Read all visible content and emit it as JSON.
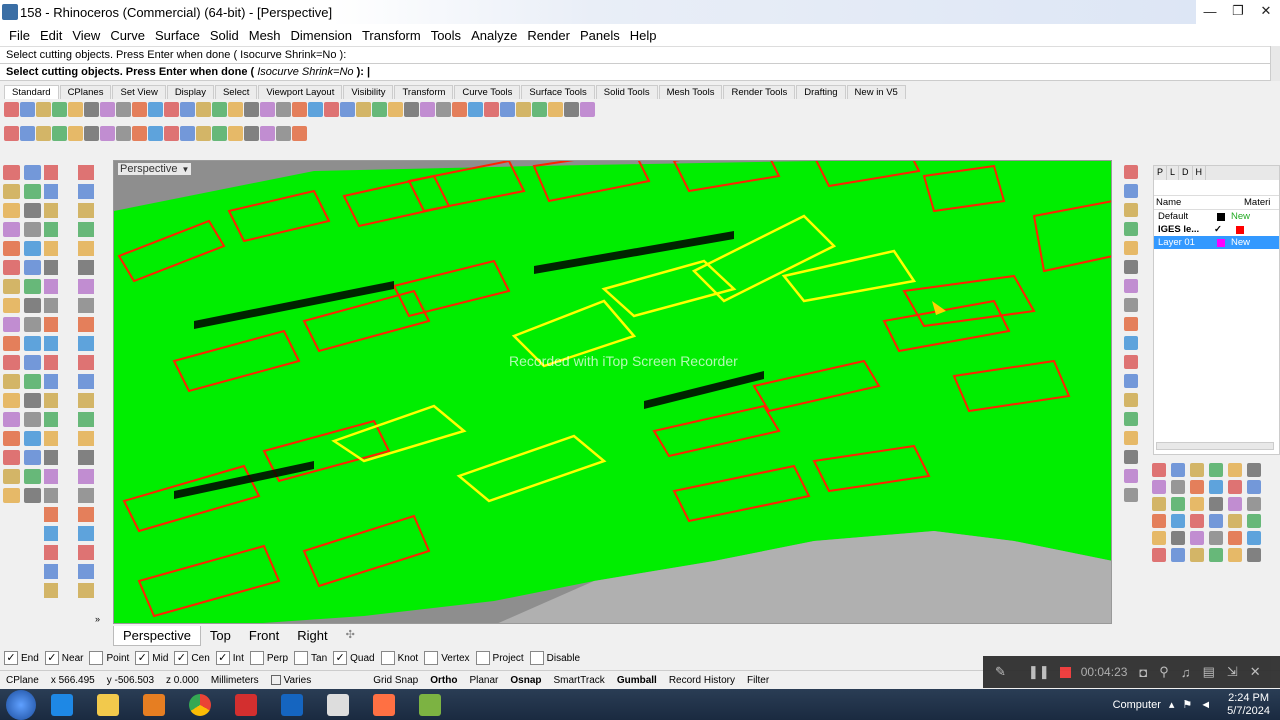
{
  "window": {
    "title": "158 - Rhinoceros (Commercial) (64-bit) - [Perspective]",
    "min": "—",
    "max": "❐",
    "close": "✕"
  },
  "menu": [
    "File",
    "Edit",
    "View",
    "Curve",
    "Surface",
    "Solid",
    "Mesh",
    "Dimension",
    "Transform",
    "Tools",
    "Analyze",
    "Render",
    "Panels",
    "Help"
  ],
  "command": {
    "history": "Select cutting objects. Press Enter when done ( Isocurve  Shrink=No ):",
    "prompt": "Select cutting objects. Press Enter when done (",
    "opt1": "Isocurve",
    "opt2": "Shrink=No",
    "tail": "):"
  },
  "toolbar_tabs": [
    "Standard",
    "CPlanes",
    "Set View",
    "Display",
    "Select",
    "Viewport Layout",
    "Visibility",
    "Transform",
    "Curve Tools",
    "Surface Tools",
    "Solid Tools",
    "Mesh Tools",
    "Render Tools",
    "Drafting",
    "New in V5"
  ],
  "viewport": {
    "label": "Perspective",
    "watermark": "Recorded with iTop Screen Recorder"
  },
  "viewport_tabs": [
    "Perspective",
    "Top",
    "Front",
    "Right"
  ],
  "osnap": [
    {
      "label": "End",
      "checked": true
    },
    {
      "label": "Near",
      "checked": true
    },
    {
      "label": "Point",
      "checked": false
    },
    {
      "label": "Mid",
      "checked": true
    },
    {
      "label": "Cen",
      "checked": true
    },
    {
      "label": "Int",
      "checked": true
    },
    {
      "label": "Perp",
      "checked": false
    },
    {
      "label": "Tan",
      "checked": false
    },
    {
      "label": "Quad",
      "checked": true
    },
    {
      "label": "Knot",
      "checked": false
    },
    {
      "label": "Vertex",
      "checked": false
    },
    {
      "label": "Project",
      "checked": false
    },
    {
      "label": "Disable",
      "checked": false
    }
  ],
  "status": {
    "cplane": "CPlane",
    "x": "x 566.495",
    "y": "y -506.503",
    "z": "z 0.000",
    "units": "Millimeters",
    "layer": "Varies",
    "toggles": [
      {
        "label": "Grid Snap",
        "bold": false
      },
      {
        "label": "Ortho",
        "bold": true
      },
      {
        "label": "Planar",
        "bold": false
      },
      {
        "label": "Osnap",
        "bold": true
      },
      {
        "label": "SmartTrack",
        "bold": false
      },
      {
        "label": "Gumball",
        "bold": true
      },
      {
        "label": "Record History",
        "bold": false
      },
      {
        "label": "Filter",
        "bold": false
      }
    ]
  },
  "layers_panel": {
    "tabs": [
      "P",
      "L",
      "D",
      "H"
    ],
    "header_name": "Name",
    "header_material": "Materi",
    "rows": [
      {
        "name": "Default",
        "color": "#000000",
        "mat": "New",
        "selected": false
      },
      {
        "name": "IGES le...",
        "check": "✓",
        "color": "#ff0000",
        "mat": "",
        "selected": false
      },
      {
        "name": "Layer 01",
        "color": "#ff00ff",
        "mat": "New",
        "selected": true
      }
    ]
  },
  "recorder": {
    "time": "00:04:23"
  },
  "taskbar": {
    "computer": "Computer",
    "time": "2:24 PM",
    "date": "5/7/2024"
  }
}
